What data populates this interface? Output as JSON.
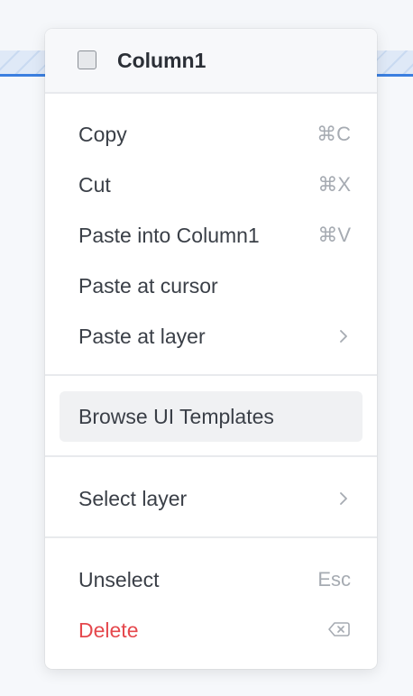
{
  "header": {
    "title": "Column1"
  },
  "menu": {
    "copy": {
      "label": "Copy",
      "shortcut": "⌘C"
    },
    "cut": {
      "label": "Cut",
      "shortcut": "⌘X"
    },
    "paste_into": {
      "label": "Paste into Column1",
      "shortcut": "⌘V"
    },
    "paste_cursor": {
      "label": "Paste at cursor"
    },
    "paste_layer": {
      "label": "Paste at layer"
    },
    "browse_templates": {
      "label": "Browse UI Templates"
    },
    "select_layer": {
      "label": "Select layer"
    },
    "unselect": {
      "label": "Unselect",
      "shortcut": "Esc"
    },
    "delete": {
      "label": "Delete"
    }
  },
  "colors": {
    "danger": "#e5484d",
    "accent": "#3b7fe0",
    "highlight": "#f0f1f3"
  },
  "icons": {
    "checkbox": "checkbox-icon",
    "submenu": "chevron-right-icon",
    "delete_key": "backspace-icon"
  }
}
